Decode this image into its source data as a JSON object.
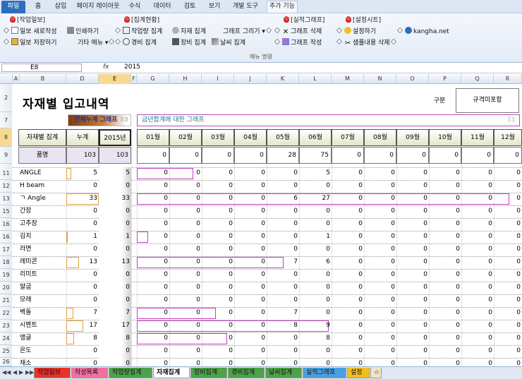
{
  "menu": {
    "tabs": [
      "파일",
      "홈",
      "삽입",
      "페이지 레이아웃",
      "수식",
      "데이터",
      "검토",
      "보기",
      "개발 도구",
      "추가 기능"
    ],
    "active": "추가 기능"
  },
  "ribbon": {
    "groups": [
      {
        "header": "[작업일보]",
        "items": [
          "일보 새로작성",
          "인쇄하기",
          "일보 저장하기",
          "기타 메뉴 ▾"
        ]
      },
      {
        "header": "[집계현황]",
        "items": [
          "작업량 집계",
          "자재 집계",
          "경비 집계",
          "장비 집계",
          "날씨 집계",
          "그래프 그리기 ▾"
        ]
      },
      {
        "header": "[실적그래프]",
        "items": [
          "그래프 삭제",
          "그래프 작성"
        ]
      },
      {
        "header": "[설정시트]",
        "items": [
          "설정하기",
          "샘플내용 삭제"
        ]
      }
    ],
    "site": "kangha.net",
    "caption": "메뉴 명령"
  },
  "formula_bar": {
    "name_box": "E8",
    "fx": "fx",
    "value": "2015"
  },
  "columns": [
    "A",
    "B",
    "D",
    "E",
    "F",
    "G",
    "H",
    "I",
    "J",
    "K",
    "L",
    "M",
    "N",
    "O",
    "P",
    "Q",
    "R"
  ],
  "selected_column": "E",
  "selected_row": "8",
  "rows": [
    "2",
    "7",
    "8",
    "9",
    "11",
    "12",
    "13",
    "15",
    "16",
    "16",
    "17",
    "18",
    "19",
    "20",
    "21",
    "22",
    "23",
    "24",
    "25",
    "26"
  ],
  "sheet": {
    "title": "자재별 입고내역",
    "total_graph_label": "전체누계 그래프",
    "total_graph_badge": "33",
    "month_graph_label": "금년합계에 대한 그래프",
    "month_graph_badge": "33",
    "gubun_label": "구분",
    "kyu_label": "규격미포함",
    "header": {
      "agg": "자재별 집계",
      "cum": "누계",
      "year": "2015년",
      "months": [
        "01월",
        "02월",
        "03월",
        "04월",
        "05월",
        "06월",
        "07월",
        "08월",
        "09월",
        "10월",
        "11월",
        "12월"
      ]
    },
    "item_row": {
      "label": "품명",
      "cum": 103,
      "year": 103,
      "months": [
        0,
        0,
        0,
        0,
        28,
        75,
        0,
        0,
        0,
        0,
        0,
        0
      ]
    },
    "items": [
      {
        "name": "ANGLE",
        "cum": 5,
        "year": 5,
        "months": [
          0,
          0,
          0,
          0,
          0,
          5,
          0,
          0,
          0,
          0,
          0,
          0
        ]
      },
      {
        "name": "H beam",
        "cum": 0,
        "year": 0,
        "months": [
          0,
          0,
          0,
          0,
          0,
          0,
          0,
          0,
          0,
          0,
          0,
          0
        ]
      },
      {
        "name": "ㄱ Angle",
        "cum": 33,
        "year": 33,
        "months": [
          0,
          0,
          0,
          0,
          6,
          27,
          0,
          0,
          0,
          0,
          0,
          0
        ]
      },
      {
        "name": "간장",
        "cum": 0,
        "year": 0,
        "months": [
          0,
          0,
          0,
          0,
          0,
          0,
          0,
          0,
          0,
          0,
          0,
          0
        ]
      },
      {
        "name": "고추장",
        "cum": 0,
        "year": 0,
        "months": [
          0,
          0,
          0,
          0,
          0,
          0,
          0,
          0,
          0,
          0,
          0,
          0
        ]
      },
      {
        "name": "김치",
        "cum": 1,
        "year": 1,
        "months": [
          0,
          0,
          0,
          0,
          0,
          1,
          0,
          0,
          0,
          0,
          0,
          0
        ]
      },
      {
        "name": "라면",
        "cum": 0,
        "year": 0,
        "months": [
          0,
          0,
          0,
          0,
          0,
          0,
          0,
          0,
          0,
          0,
          0,
          0
        ]
      },
      {
        "name": "레미콘",
        "cum": 13,
        "year": 13,
        "months": [
          0,
          0,
          0,
          0,
          7,
          6,
          0,
          0,
          0,
          0,
          0,
          0
        ]
      },
      {
        "name": "리미트",
        "cum": 0,
        "year": 0,
        "months": [
          0,
          0,
          0,
          0,
          0,
          0,
          0,
          0,
          0,
          0,
          0,
          0
        ]
      },
      {
        "name": "말굽",
        "cum": 0,
        "year": 0,
        "months": [
          0,
          0,
          0,
          0,
          0,
          0,
          0,
          0,
          0,
          0,
          0,
          0
        ]
      },
      {
        "name": "모래",
        "cum": 0,
        "year": 0,
        "months": [
          0,
          0,
          0,
          0,
          0,
          0,
          0,
          0,
          0,
          0,
          0,
          0
        ]
      },
      {
        "name": "벽돌",
        "cum": 7,
        "year": 7,
        "months": [
          0,
          0,
          0,
          0,
          7,
          0,
          0,
          0,
          0,
          0,
          0,
          0
        ]
      },
      {
        "name": "시멘트",
        "cum": 17,
        "year": 17,
        "months": [
          0,
          0,
          0,
          0,
          8,
          9,
          0,
          0,
          0,
          0,
          0,
          0
        ]
      },
      {
        "name": "앵글",
        "cum": 8,
        "year": 8,
        "months": [
          0,
          0,
          0,
          0,
          0,
          8,
          0,
          0,
          0,
          0,
          0,
          0
        ]
      },
      {
        "name": "온도",
        "cum": 0,
        "year": 0,
        "months": [
          0,
          0,
          0,
          0,
          0,
          0,
          0,
          0,
          0,
          0,
          0,
          0
        ]
      },
      {
        "name": "채소",
        "cum": 0,
        "year": 0,
        "months": [
          0,
          0,
          0,
          0,
          0,
          0,
          0,
          0,
          0,
          0,
          0,
          0
        ]
      }
    ]
  },
  "sheet_tabs": [
    {
      "label": "작업일보",
      "color": "#e8322a"
    },
    {
      "label": "작성목록",
      "color": "#f06ea0"
    },
    {
      "label": "작업량집계",
      "color": "#4ea24a"
    },
    {
      "label": "자재집계",
      "color": "#ffffff"
    },
    {
      "label": "장비집계",
      "color": "#4ea24a"
    },
    {
      "label": "경비집계",
      "color": "#4ea24a"
    },
    {
      "label": "날씨집계",
      "color": "#4ea24a"
    },
    {
      "label": "실적그래프",
      "color": "#4aa0e0"
    },
    {
      "label": "설정",
      "color": "#f0c020"
    }
  ],
  "active_sheet": "자재집계"
}
